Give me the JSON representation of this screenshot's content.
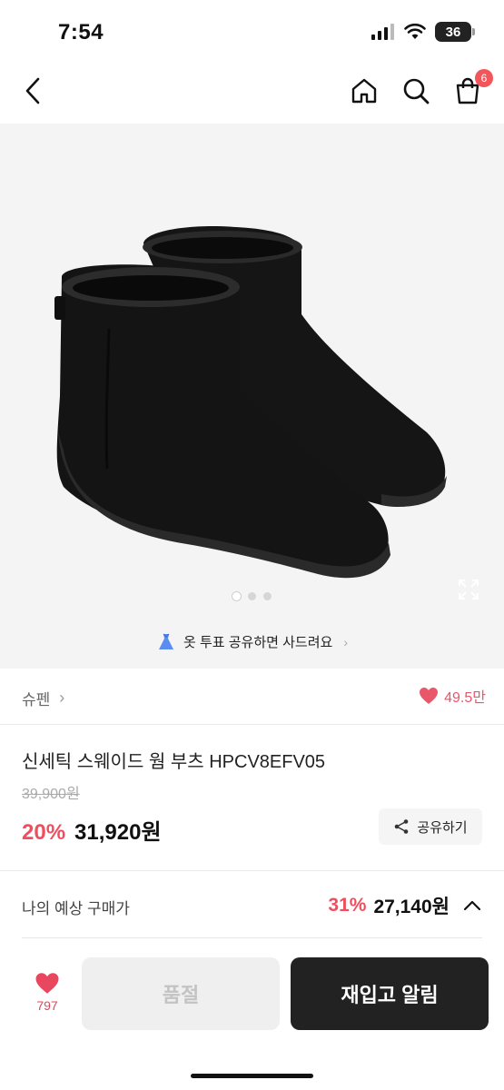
{
  "status": {
    "time": "7:54",
    "battery": "36"
  },
  "nav": {
    "cart_count": "6"
  },
  "hero": {
    "image_count": 3,
    "active_index": 1,
    "promo_text": "옷 투표 공유하면 사드려요"
  },
  "brand": {
    "name": "슈펜",
    "likes": "49.5만"
  },
  "product": {
    "name": "신세틱 스웨이드 웜 부츠 HPCV8EFV05",
    "original_price": "39,900원",
    "discount": "20%",
    "price": "31,920원"
  },
  "share": {
    "label": "공유하기"
  },
  "my_price": {
    "label": "나의 예상 구매가",
    "discount": "31%",
    "price": "27,140원"
  },
  "bottom": {
    "wish_count": "797",
    "soldout_label": "품절",
    "restock_label": "재입고 알림"
  },
  "colors": {
    "accent": "#f04e5f",
    "dark_button": "#222222",
    "badge": "#f2555a"
  }
}
